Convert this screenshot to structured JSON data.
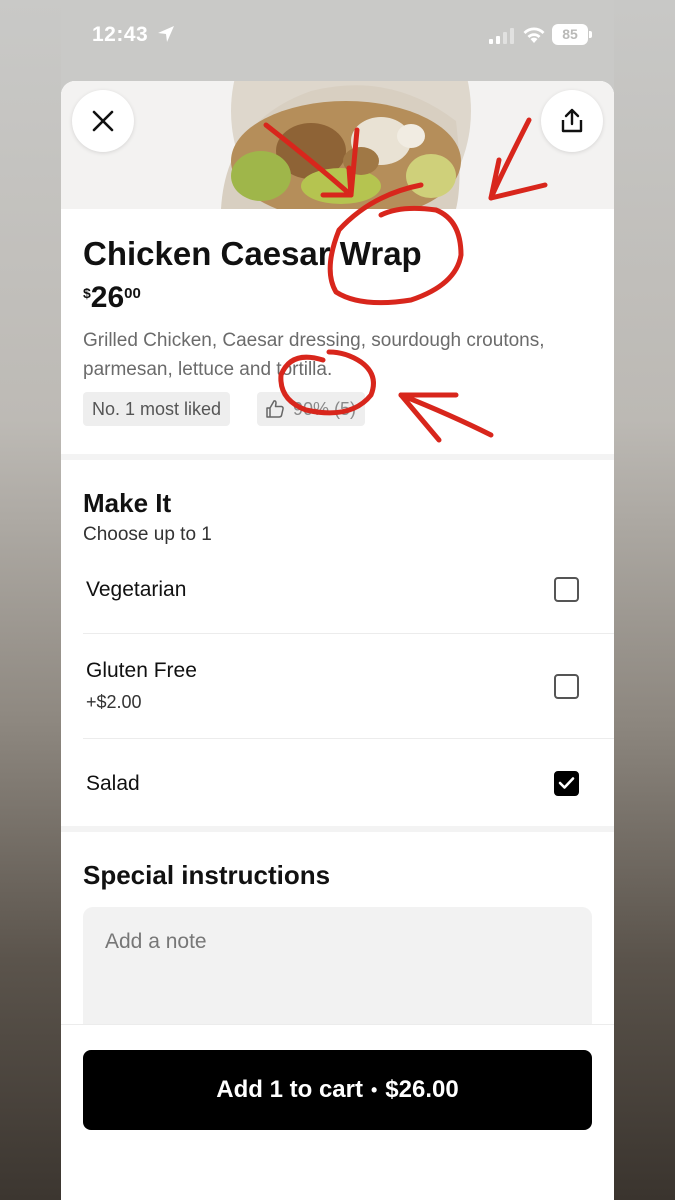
{
  "status_bar": {
    "time": "12:43",
    "battery": "85"
  },
  "item": {
    "name": "Chicken Caesar Wrap",
    "price_currency": "$",
    "price_whole": "26",
    "price_cents": "00",
    "description": "Grilled Chicken, Caesar dressing, sourdough croutons, parmesan, lettuce and tortilla.",
    "badge_liked": "No. 1 most liked",
    "badge_rating": "90% (5)"
  },
  "make_it": {
    "title": "Make It",
    "subtitle": "Choose up to 1",
    "options": [
      {
        "label": "Vegetarian",
        "price": "",
        "checked": false
      },
      {
        "label": "Gluten Free",
        "price": "+$2.00",
        "checked": false
      },
      {
        "label": "Salad",
        "price": "",
        "checked": true
      }
    ]
  },
  "special_instructions": {
    "title": "Special instructions",
    "placeholder": "Add a note"
  },
  "cart": {
    "label": "Add 1 to cart",
    "separator": "•",
    "total": "$26.00"
  },
  "colors": {
    "annotation": "#d8261c",
    "button": "#000000",
    "chip_bg": "#eeeeee"
  }
}
